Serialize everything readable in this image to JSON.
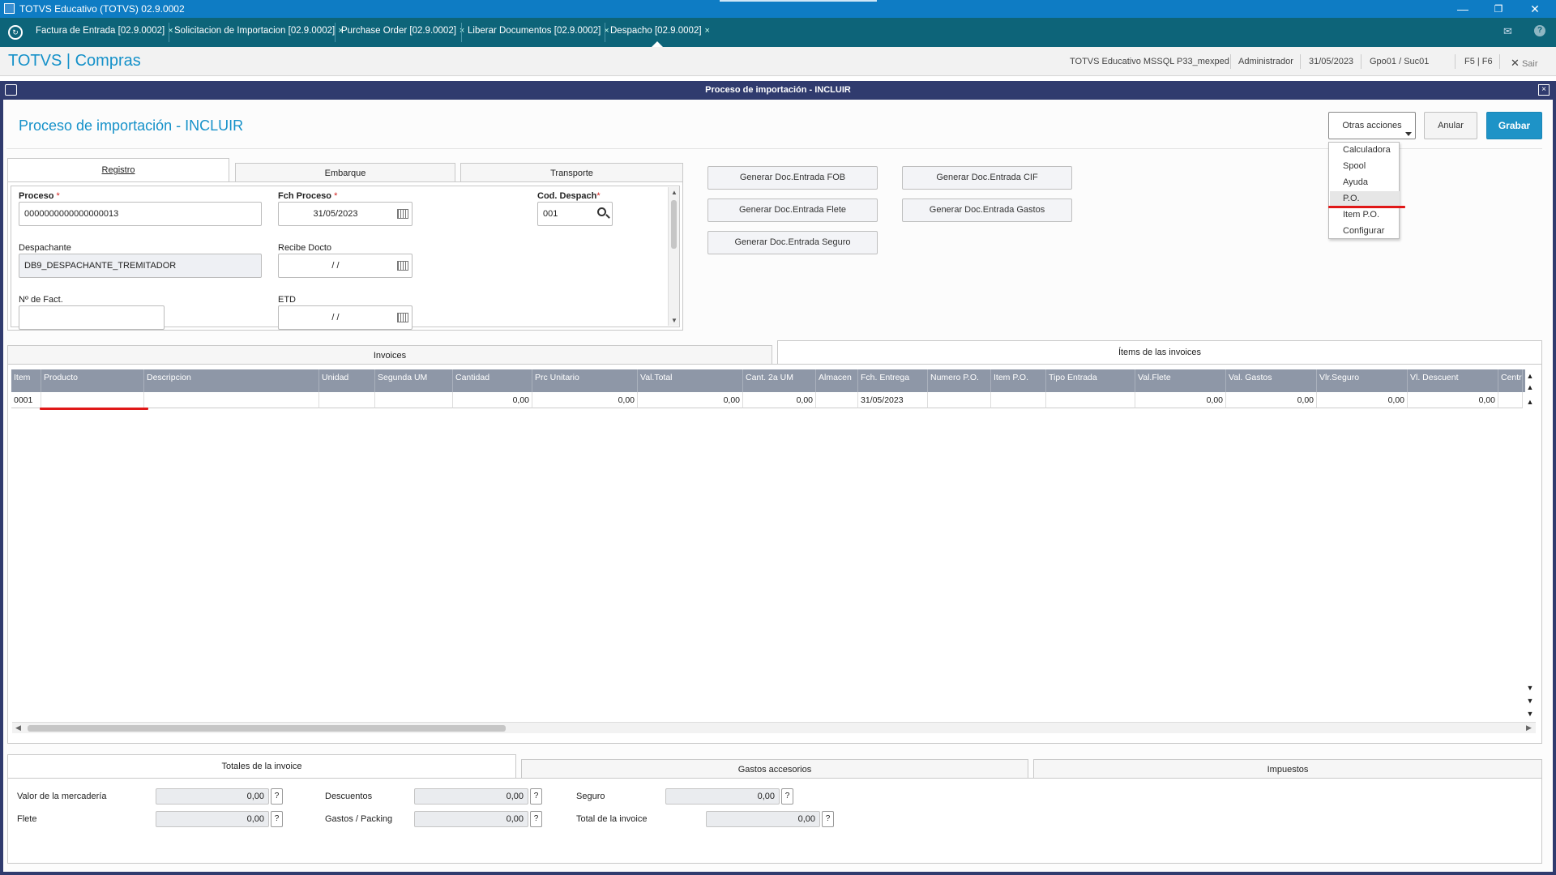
{
  "window": {
    "title": "TOTVS Educativo (TOTVS) 02.9.0002"
  },
  "tabs": [
    {
      "label": "Factura de Entrada [02.9.0002]"
    },
    {
      "label": "Solicitacion de Importacion [02.9.0002]"
    },
    {
      "label": "Purchase Order [02.9.0002]"
    },
    {
      "label": "Liberar Documentos [02.9.0002]"
    },
    {
      "label": "Despacho [02.9.0002]"
    }
  ],
  "header": {
    "brand": "TOTVS | Compras",
    "environment": "TOTVS Educativo MSSQL P33_mexped",
    "user": "Administrador",
    "date": "31/05/2023",
    "company": "Gpo01 / Suc01",
    "shortcuts": "F5 | F6",
    "exit_label": "Sair"
  },
  "dialog": {
    "title": "Proceso de importación - INCLUIR",
    "page_title": "Proceso de importación - INCLUIR"
  },
  "actions": {
    "more_label": "Otras acciones",
    "cancel_label": "Anular",
    "save_label": "Grabar",
    "menu": [
      {
        "label": "Calculadora"
      },
      {
        "label": "Spool"
      },
      {
        "label": "Ayuda"
      },
      {
        "label": "P.O."
      },
      {
        "label": "Item P.O."
      },
      {
        "label": "Configurar"
      }
    ]
  },
  "form_tabs": [
    {
      "label": "Registro"
    },
    {
      "label": "Embarque"
    },
    {
      "label": "Transporte"
    }
  ],
  "form": {
    "proceso": {
      "label": "Proceso",
      "value": "0000000000000000013"
    },
    "fch_proceso": {
      "label": "Fch Proceso",
      "value": "31/05/2023"
    },
    "cod_despach": {
      "label": "Cod. Despach",
      "value": "001"
    },
    "despachante": {
      "label": "Despachante",
      "value": "DB9_DESPACHANTE_TREMITADOR"
    },
    "recibe_docto": {
      "label": "Recibe Docto",
      "value": "/ /"
    },
    "nro_fact": {
      "label": "Nº de Fact.",
      "value": ""
    },
    "etd": {
      "label": "ETD",
      "value": "/ /"
    }
  },
  "gen_buttons": [
    {
      "label": "Generar Doc.Entrada FOB"
    },
    {
      "label": "Generar Doc.Entrada CIF"
    },
    {
      "label": "Generar Doc.Entrada Flete"
    },
    {
      "label": "Generar Doc.Entrada Gastos"
    },
    {
      "label": "Generar Doc.Entrada Seguro"
    }
  ],
  "grid_tabs": [
    {
      "label": "Invoices"
    },
    {
      "label": "Ítems de las invoices"
    }
  ],
  "grid": {
    "columns": [
      "Item",
      "Producto",
      "Descripcion",
      "Unidad",
      "Segunda UM",
      "Cantidad",
      "Prc Unitario",
      "Val.Total",
      "Cant. 2a UM",
      "Almacen",
      "Fch. Entrega",
      "Numero P.O.",
      "Item P.O.",
      "Tipo Entrada",
      "Val.Flete",
      "Val. Gastos",
      "Vlr.Seguro",
      "Vl. Descuent",
      "Centr"
    ],
    "rows": [
      [
        "0001",
        "",
        "",
        "",
        "",
        "0,00",
        "0,00",
        "0,00",
        "0,00",
        "",
        "31/05/2023",
        "",
        "",
        "",
        "0,00",
        "0,00",
        "0,00",
        "0,00",
        ""
      ]
    ]
  },
  "totals_tabs": [
    {
      "label": "Totales de la invoice"
    },
    {
      "label": "Gastos accesorios"
    },
    {
      "label": "Impuestos"
    }
  ],
  "totals": {
    "valor_mercaderia": {
      "label": "Valor de la mercadería",
      "value": "0,00"
    },
    "flete": {
      "label": "Flete",
      "value": "0,00"
    },
    "descuentos": {
      "label": "Descuentos",
      "value": "0,00"
    },
    "gastos_packing": {
      "label": "Gastos / Packing",
      "value": "0,00"
    },
    "seguro": {
      "label": "Seguro",
      "value": "0,00"
    },
    "total_invoice": {
      "label": "Total de la invoice",
      "value": "0,00"
    },
    "help": "?"
  },
  "colors": {
    "accent": "#1591c9",
    "titlebar": "#0e7cc4",
    "tabbar": "#0d6479",
    "dialog_bar": "#303b6e",
    "highlight": "#e01818"
  }
}
